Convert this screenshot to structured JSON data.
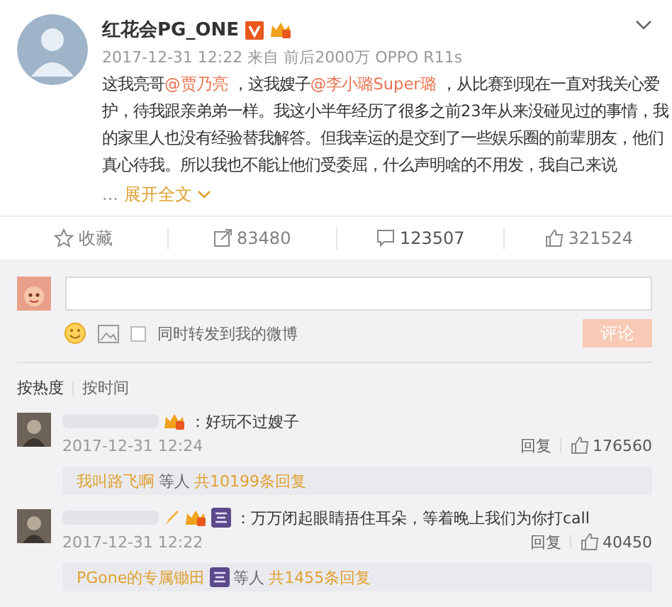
{
  "post": {
    "author": "红花会PG_ONE",
    "meta": "2017-12-31 12:22 来自 前后2000万 OPPO R11s",
    "body": [
      {
        "kind": "text",
        "text": "这我亮哥"
      },
      {
        "kind": "mention",
        "text": "@贾乃亮"
      },
      {
        "kind": "text",
        "text": " ，这我嫂子"
      },
      {
        "kind": "mention",
        "text": "@李小璐Super璐"
      },
      {
        "kind": "text",
        "text": " ，从比赛到现在一直对我关心爱护，待我跟亲弟弟一样。我这小半年经历了很多之前23年从来没碰见过的事情，我的家里人也没有经验替我解答。但我幸运的是交到了一些娱乐圈的前辈朋友，他们真心待我。所以我也不能让他们受委屈，什么声明啥的不用发，我自己来说"
      }
    ],
    "ellipsis": "...",
    "expand": "展开全文",
    "actions": [
      {
        "kind": "favorite",
        "label": "收藏",
        "selected": false
      },
      {
        "kind": "repost",
        "label": "83480",
        "selected": false
      },
      {
        "kind": "comment",
        "label": "123507",
        "selected": true
      },
      {
        "kind": "like",
        "label": "321524",
        "selected": false
      }
    ]
  },
  "composer": {
    "checkbox_label": "同时转发到我的微博",
    "checked": false,
    "submit": "评论",
    "submit_disabled": true
  },
  "sort_tabs": [
    {
      "label": "按热度",
      "selected": true
    },
    {
      "label": "按时间",
      "selected": false
    }
  ],
  "comments": [
    {
      "text": "：好玩不过嫂子",
      "time": "2017-12-31 12:24",
      "reply": "回复",
      "likes": "176560",
      "summary": [
        {
          "kind": "user",
          "text": "我叫路飞啊"
        },
        {
          "kind": "text",
          "text": "等人"
        },
        {
          "kind": "count",
          "text": "共10199条回复"
        }
      ]
    },
    {
      "text": "：万万闭起眼睛捂住耳朵，等着晚上我们为你打call",
      "time": "2017-12-31 12:22",
      "reply": "回复",
      "likes": "40450",
      "summary": [
        {
          "kind": "user",
          "text": "PGone的专属锄田"
        },
        {
          "kind": "badge"
        },
        {
          "kind": "text",
          "text": "等人"
        },
        {
          "kind": "count",
          "text": "共1455条回复"
        }
      ]
    }
  ]
}
